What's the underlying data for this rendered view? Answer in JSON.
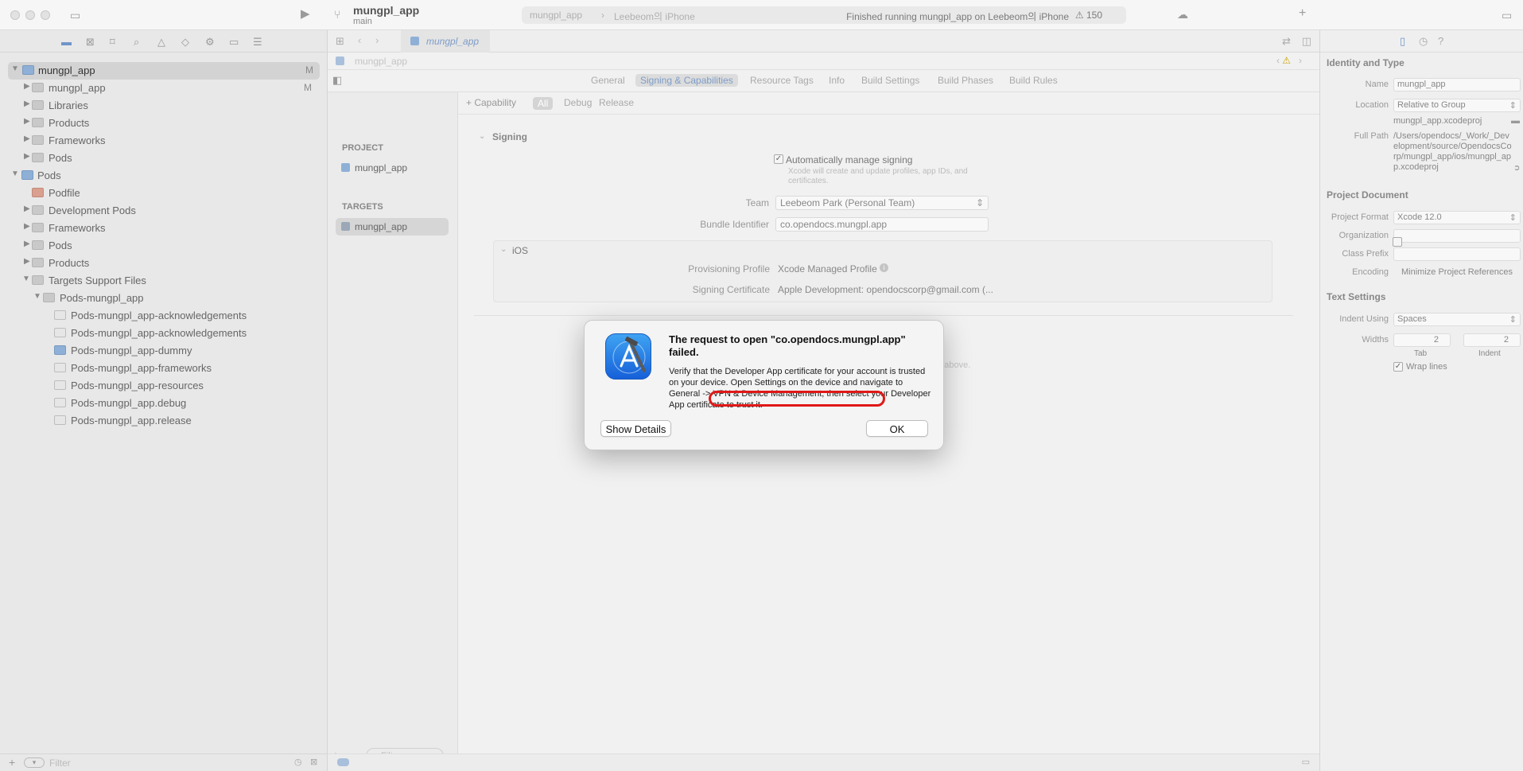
{
  "toolbar": {
    "scheme_title": "mungpl_app",
    "scheme_branch": "main",
    "destination_app": "mungpl_app",
    "destination_device": "Leebeom의 iPhone",
    "status": "Finished running mungpl_app on Leebeom의 iPhone",
    "warning_count": "150"
  },
  "navigator": {
    "rows": [
      {
        "label": "mungpl_app",
        "badge": "M"
      },
      {
        "label": "mungpl_app",
        "badge": "M"
      },
      {
        "label": "Libraries"
      },
      {
        "label": "Products"
      },
      {
        "label": "Frameworks"
      },
      {
        "label": "Pods"
      },
      {
        "label": "Pods"
      },
      {
        "label": "Podfile"
      },
      {
        "label": "Development Pods"
      },
      {
        "label": "Frameworks"
      },
      {
        "label": "Pods"
      },
      {
        "label": "Products"
      },
      {
        "label": "Targets Support Files"
      },
      {
        "label": "Pods-mungpl_app"
      },
      {
        "label": "Pods-mungpl_app-acknowledgements"
      },
      {
        "label": "Pods-mungpl_app-acknowledgements"
      },
      {
        "label": "Pods-mungpl_app-dummy"
      },
      {
        "label": "Pods-mungpl_app-frameworks"
      },
      {
        "label": "Pods-mungpl_app-resources"
      },
      {
        "label": "Pods-mungpl_app.debug"
      },
      {
        "label": "Pods-mungpl_app.release"
      }
    ],
    "filter_placeholder": "Filter"
  },
  "editor": {
    "file_tab": "mungpl_app",
    "jumpbar": "mungpl_app",
    "tabs": [
      "General",
      "Signing & Capabilities",
      "Resource Tags",
      "Info",
      "Build Settings",
      "Build Phases",
      "Build Rules"
    ],
    "project_header": "PROJECT",
    "project_item": "mungpl_app",
    "targets_header": "TARGETS",
    "target_item": "mungpl_app",
    "target_filter": "Filter",
    "capability_btn": "+ Capability",
    "config_tabs": [
      "All",
      "Debug",
      "Release"
    ],
    "signing_title": "Signing",
    "auto_signing": "Automatically manage signing",
    "auto_signing_note": "Xcode will create and update profiles, app IDs, and certificates.",
    "team_label": "Team",
    "team_value": "Leebeom Park (Personal Team)",
    "bundle_label": "Bundle Identifier",
    "bundle_value": "co.opendocs.mungpl.app",
    "ios_title": "iOS",
    "prov_label": "Provisioning Profile",
    "prov_value": "Xcode Managed Profile",
    "cert_label": "Signing Certificate",
    "cert_value": "Apple Development: opendocscorp@gmail.com (...",
    "faded_note": "on above."
  },
  "inspector": {
    "identity_title": "Identity and Type",
    "name_label": "Name",
    "name_value": "mungpl_app",
    "location_label": "Location",
    "location_value": "Relative to Group",
    "filename": "mungpl_app.xcodeproj",
    "fullpath_label": "Full Path",
    "fullpath_value": "/Users/opendocs/_Work/_Development/source/OpendocsCorp/mungpl_app/ios/mungpl_app.xcodeproj",
    "project_doc_title": "Project Document",
    "format_label": "Project Format",
    "format_value": "Xcode 12.0",
    "org_label": "Organization",
    "prefix_label": "Class Prefix",
    "encoding_label": "Encoding",
    "encoding_value": "Minimize Project References",
    "text_settings_title": "Text Settings",
    "indent_label": "Indent Using",
    "indent_value": "Spaces",
    "widths_label": "Widths",
    "tab_width": "2",
    "indent_width": "2",
    "tab_label": "Tab",
    "indent_sub_label": "Indent",
    "wrap_label": "Wrap lines"
  },
  "alert": {
    "title": "The request to open \"co.opendocs.mungpl.app\" failed.",
    "msg_part1": "Verify that the Developer App certificate for your account is trusted on your device. Open Settings on the device and navigate to ",
    "msg_highlight": "General -> VPN & Device Management,",
    "msg_part2": " then select your Developer App certificate to trust it.",
    "details_btn": "Show Details",
    "ok_btn": "OK"
  }
}
